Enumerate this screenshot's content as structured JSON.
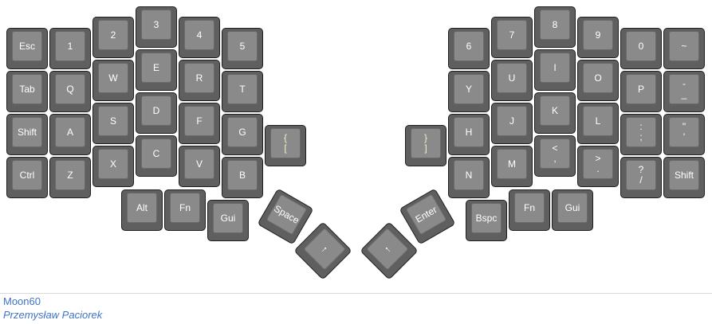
{
  "keyboard": {
    "name": "Moon60",
    "author": "Przemysław Paciorek",
    "keys": [
      {
        "id": "esc",
        "labels": [
          "Esc"
        ]
      },
      {
        "id": "1",
        "labels": [
          "1"
        ]
      },
      {
        "id": "2",
        "labels": [
          "2"
        ]
      },
      {
        "id": "3",
        "labels": [
          "3"
        ]
      },
      {
        "id": "4",
        "labels": [
          "4"
        ]
      },
      {
        "id": "5",
        "labels": [
          "5"
        ]
      },
      {
        "id": "tab",
        "labels": [
          "Tab"
        ]
      },
      {
        "id": "q",
        "labels": [
          "Q"
        ]
      },
      {
        "id": "w",
        "labels": [
          "W"
        ]
      },
      {
        "id": "e",
        "labels": [
          "E"
        ]
      },
      {
        "id": "r",
        "labels": [
          "R"
        ]
      },
      {
        "id": "t",
        "labels": [
          "T"
        ]
      },
      {
        "id": "shift-left",
        "labels": [
          "Shift"
        ]
      },
      {
        "id": "a",
        "labels": [
          "A"
        ]
      },
      {
        "id": "s",
        "labels": [
          "S"
        ]
      },
      {
        "id": "d",
        "labels": [
          "D"
        ]
      },
      {
        "id": "f",
        "labels": [
          "F"
        ]
      },
      {
        "id": "g",
        "labels": [
          "G"
        ]
      },
      {
        "id": "brace-open",
        "labels": [
          "{",
          "["
        ]
      },
      {
        "id": "ctrl",
        "labels": [
          "Ctrl"
        ]
      },
      {
        "id": "z",
        "labels": [
          "Z"
        ]
      },
      {
        "id": "x",
        "labels": [
          "X"
        ]
      },
      {
        "id": "c",
        "labels": [
          "C"
        ]
      },
      {
        "id": "v",
        "labels": [
          "V"
        ]
      },
      {
        "id": "b",
        "labels": [
          "B"
        ]
      },
      {
        "id": "alt",
        "labels": [
          "Alt"
        ]
      },
      {
        "id": "fn-left",
        "labels": [
          "Fn"
        ]
      },
      {
        "id": "gui-left",
        "labels": [
          "Gui"
        ]
      },
      {
        "id": "space",
        "labels": [
          "Space"
        ]
      },
      {
        "id": "arrow-left-thumb",
        "labels": [
          "↑"
        ]
      },
      {
        "id": "arrow-right-thumb",
        "labels": [
          "↑"
        ]
      },
      {
        "id": "enter",
        "labels": [
          "Enter"
        ]
      },
      {
        "id": "bspc",
        "labels": [
          "Bspc"
        ]
      },
      {
        "id": "fn-right",
        "labels": [
          "Fn"
        ]
      },
      {
        "id": "gui-right",
        "labels": [
          "Gui"
        ]
      },
      {
        "id": "6",
        "labels": [
          "6"
        ]
      },
      {
        "id": "7",
        "labels": [
          "7"
        ]
      },
      {
        "id": "8",
        "labels": [
          "8"
        ]
      },
      {
        "id": "9",
        "labels": [
          "9"
        ]
      },
      {
        "id": "0",
        "labels": [
          "0"
        ]
      },
      {
        "id": "tilde",
        "labels": [
          "~"
        ]
      },
      {
        "id": "y",
        "labels": [
          "Y"
        ]
      },
      {
        "id": "u",
        "labels": [
          "U"
        ]
      },
      {
        "id": "i",
        "labels": [
          "I"
        ]
      },
      {
        "id": "o",
        "labels": [
          "O"
        ]
      },
      {
        "id": "p",
        "labels": [
          "P"
        ]
      },
      {
        "id": "minus",
        "labels": [
          "-",
          "_"
        ]
      },
      {
        "id": "brace-close",
        "labels": [
          "}",
          "]"
        ]
      },
      {
        "id": "h",
        "labels": [
          "H"
        ]
      },
      {
        "id": "j",
        "labels": [
          "J"
        ]
      },
      {
        "id": "k",
        "labels": [
          "K"
        ]
      },
      {
        "id": "l",
        "labels": [
          "L"
        ]
      },
      {
        "id": "semicolon",
        "labels": [
          ":",
          ";"
        ]
      },
      {
        "id": "quote",
        "labels": [
          "\"",
          "'"
        ]
      },
      {
        "id": "n",
        "labels": [
          "N"
        ]
      },
      {
        "id": "m",
        "labels": [
          "M"
        ]
      },
      {
        "id": "comma",
        "labels": [
          "<",
          ","
        ]
      },
      {
        "id": "period",
        "labels": [
          ">",
          "."
        ]
      },
      {
        "id": "slash",
        "labels": [
          "?",
          "/"
        ]
      },
      {
        "id": "shift-right",
        "labels": [
          "Shift"
        ]
      }
    ]
  }
}
